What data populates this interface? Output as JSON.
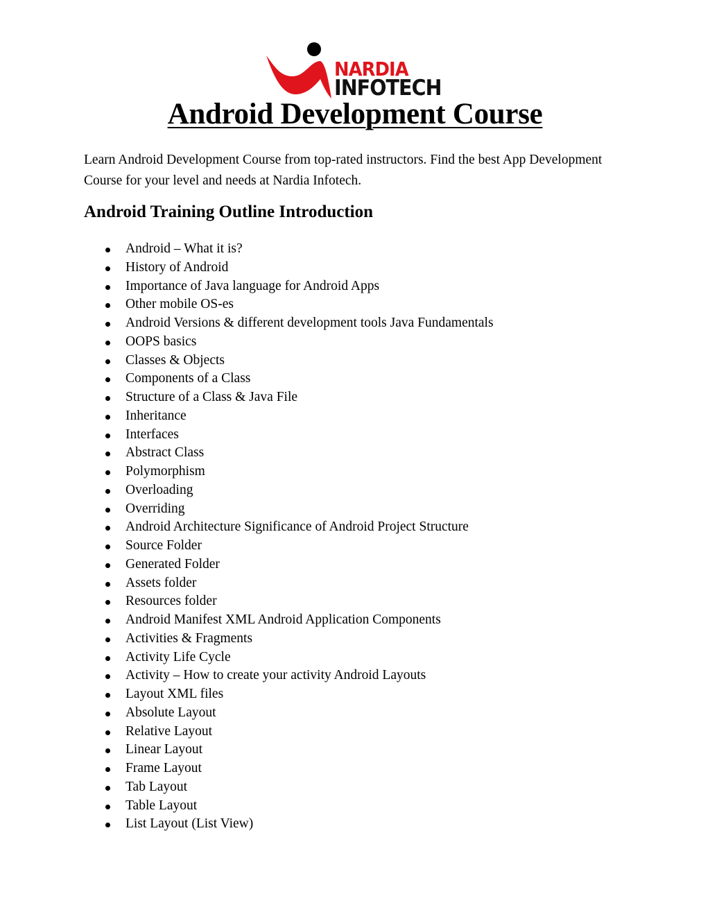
{
  "logo": {
    "line1": "NARDIA",
    "line2": "INFOTECH",
    "colors": {
      "brand_red": "#e0141c",
      "brand_black": "#111111"
    }
  },
  "title": "Android Development Course",
  "intro": "Learn Android Development Course from top-rated instructors. Find the best App Development Course for your level and needs at Nardia Infotech.",
  "section_heading": "Android Training Outline Introduction",
  "outline_items": [
    "Android – What it is?",
    "History of Android",
    "Importance of Java language for Android Apps",
    "Other mobile OS-es",
    "Android Versions & different development tools Java Fundamentals",
    "OOPS basics",
    "Classes & Objects",
    "Components of a Class",
    "Structure of a Class & Java File",
    "Inheritance",
    "Interfaces",
    "Abstract Class",
    "Polymorphism",
    "Overloading",
    "Overriding",
    "Android Architecture Significance of Android Project Structure",
    "Source Folder",
    "Generated Folder",
    "Assets folder",
    "Resources folder",
    "Android Manifest XML Android Application Components",
    "Activities & Fragments",
    "Activity Life Cycle",
    "Activity – How to create your activity Android Layouts",
    "Layout XML files",
    "Absolute Layout",
    "Relative Layout",
    "Linear Layout",
    "Frame Layout",
    "Tab Layout",
    "Table Layout",
    "List Layout (List View)"
  ]
}
